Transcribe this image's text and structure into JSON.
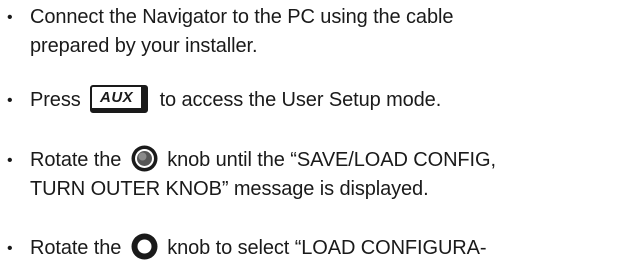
{
  "instructions": {
    "bullet_glyph": "•",
    "items": [
      {
        "lines": [
          "Connect the Navigator to the PC using the cable",
          "prepared by your installer."
        ]
      },
      {
        "before": "Press",
        "key_label": "AUX",
        "after": "to access the User Setup mode."
      },
      {
        "before": "Rotate the",
        "knob_icon": "inner-knob-icon",
        "after": "knob until the “SAVE/LOAD CONFIG,",
        "line2": "TURN OUTER KNOB” message is displayed."
      },
      {
        "before": "Rotate the",
        "knob_icon": "outer-knob-icon",
        "after": "knob to select “LOAD CONFIGURA-"
      }
    ]
  }
}
